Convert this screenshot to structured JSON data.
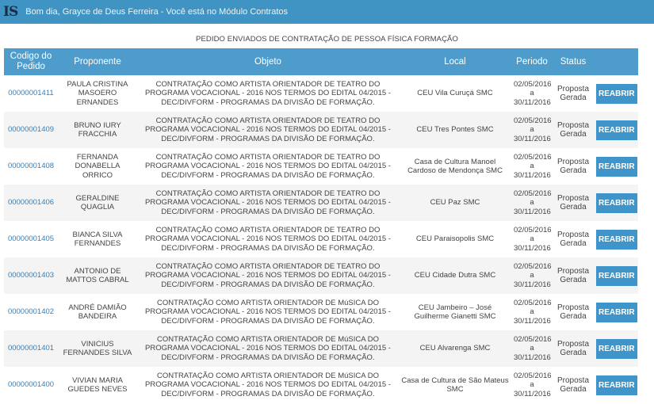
{
  "header": {
    "logo": "IS",
    "greeting": "Bom dia, Grayce de Deus Ferreira - Você está no Módulo Contratos"
  },
  "page_title": "PEDIDO ENVIADOS DE CONTRATAÇÃO DE PESSOA FÍSICA FORMAÇÃO",
  "columns": {
    "codigo": "Codigo do Pedido",
    "proponente": "Proponente",
    "objeto": "Objeto",
    "local": "Local",
    "periodo": "Periodo",
    "status": "Status"
  },
  "button_label": "REABRIR",
  "rows": [
    {
      "codigo": "00000001411",
      "proponente": "PAULA CRISTINA MASOERO ERNANDES",
      "objeto": "CONTRATAÇÃO COMO ARTISTA ORIENTADOR DE TEATRO DO PROGRAMA VOCACIONAL - 2016 NOS TERMOS DO EDITAL 04/2015 - DEC/DIVFORM - PROGRAMAS DA DIVISÃO DE FORMAÇÃO.",
      "local": "CEU Vila Curuçá SMC",
      "periodo_inicio": "02/05/2016",
      "periodo_sep": "a",
      "periodo_fim": "30/11/2016",
      "status": "Proposta Gerada"
    },
    {
      "codigo": "00000001409",
      "proponente": "BRUNO IURY FRACCHIA",
      "objeto": "CONTRATAÇÃO COMO ARTISTA ORIENTADOR DE TEATRO DO PROGRAMA VOCACIONAL - 2016 NOS TERMOS DO EDITAL 04/2015 - DEC/DIVFORM - PROGRAMAS DA DIVISÃO DE FORMAÇÃO.",
      "local": "CEU Tres Pontes SMC",
      "periodo_inicio": "02/05/2016",
      "periodo_sep": "a",
      "periodo_fim": "30/11/2016",
      "status": "Proposta Gerada"
    },
    {
      "codigo": "00000001408",
      "proponente": "FERNANDA DONABELLA ORRICO",
      "objeto": "CONTRATAÇÃO COMO ARTISTA ORIENTADOR DE TEATRO DO PROGRAMA VOCACIONAL - 2016 NOS TERMOS DO EDITAL 04/2015 - DEC/DIVFORM - PROGRAMAS DA DIVISÃO DE FORMAÇÃO.",
      "local": "Casa de Cultura Manoel Cardoso de Mendonça SMC",
      "periodo_inicio": "02/05/2016",
      "periodo_sep": "a",
      "periodo_fim": "30/11/2016",
      "status": "Proposta Gerada"
    },
    {
      "codigo": "00000001406",
      "proponente": "GERALDINE QUAGLIA",
      "objeto": "CONTRATAÇÃO COMO ARTISTA ORIENTADOR DE TEATRO DO PROGRAMA VOCACIONAL - 2016 NOS TERMOS DO EDITAL 04/2015 - DEC/DIVFORM - PROGRAMAS DA DIVISÃO DE FORMAÇÃO.",
      "local": "CEU Paz SMC",
      "periodo_inicio": "02/05/2016",
      "periodo_sep": "a",
      "periodo_fim": "30/11/2016",
      "status": "Proposta Gerada"
    },
    {
      "codigo": "00000001405",
      "proponente": "BIANCA SILVA FERNANDES",
      "objeto": "CONTRATAÇÃO COMO ARTISTA ORIENTADOR DE TEATRO DO PROGRAMA VOCACIONAL - 2016 NOS TERMOS DO EDITAL 04/2015 - DEC/DIVFORM - PROGRAMAS DA DIVISÃO DE FORMAÇÃO.",
      "local": "CEU Paraisopolis SMC",
      "periodo_inicio": "02/05/2016",
      "periodo_sep": "a",
      "periodo_fim": "30/11/2016",
      "status": "Proposta Gerada"
    },
    {
      "codigo": "00000001403",
      "proponente": "ANTONIO DE MATTOS CABRAL",
      "objeto": "CONTRATAÇÃO COMO ARTISTA ORIENTADOR DE TEATRO DO PROGRAMA VOCACIONAL - 2016 NOS TERMOS DO EDITAL 04/2015 - DEC/DIVFORM - PROGRAMAS DA DIVISÃO DE FORMAÇÃO.",
      "local": "CEU Cidade Dutra SMC",
      "periodo_inicio": "02/05/2016",
      "periodo_sep": "a",
      "periodo_fim": "30/11/2016",
      "status": "Proposta Gerada"
    },
    {
      "codigo": "00000001402",
      "proponente": "ANDRÉ DAMIÃO BANDEIRA",
      "objeto": "CONTRATAÇÃO COMO ARTISTA ORIENTADOR DE MúSICA DO PROGRAMA VOCACIONAL - 2016 NOS TERMOS DO EDITAL 04/2015 - DEC/DIVFORM - PROGRAMAS DA DIVISÃO DE FORMAÇÃO.",
      "local": "CEU Jambeiro – José Guilherme Gianetti SMC",
      "periodo_inicio": "02/05/2016",
      "periodo_sep": "a",
      "periodo_fim": "30/11/2016",
      "status": "Proposta Gerada"
    },
    {
      "codigo": "00000001401",
      "proponente": "VINICIUS FERNANDES SILVA",
      "objeto": "CONTRATAÇÃO COMO ARTISTA ORIENTADOR DE MúSICA DO PROGRAMA VOCACIONAL - 2016 NOS TERMOS DO EDITAL 04/2015 - DEC/DIVFORM - PROGRAMAS DA DIVISÃO DE FORMAÇÃO.",
      "local": "CEU Alvarenga SMC",
      "periodo_inicio": "02/05/2016",
      "periodo_sep": "a",
      "periodo_fim": "30/11/2016",
      "status": "Proposta Gerada"
    },
    {
      "codigo": "00000001400",
      "proponente": "VIVIAN MARIA GUEDES NEVES",
      "objeto": "CONTRATAÇÃO COMO ARTISTA ORIENTADOR DE MúSICA DO PROGRAMA VOCACIONAL - 2016 NOS TERMOS DO EDITAL 04/2015 - DEC/DIVFORM - PROGRAMAS DA DIVISÃO DE FORMAÇÃO.",
      "local": "Casa de Cultura de São Mateus SMC",
      "periodo_inicio": "02/05/2016",
      "periodo_sep": "a",
      "periodo_fim": "30/11/2016",
      "status": "Proposta Gerada"
    }
  ]
}
